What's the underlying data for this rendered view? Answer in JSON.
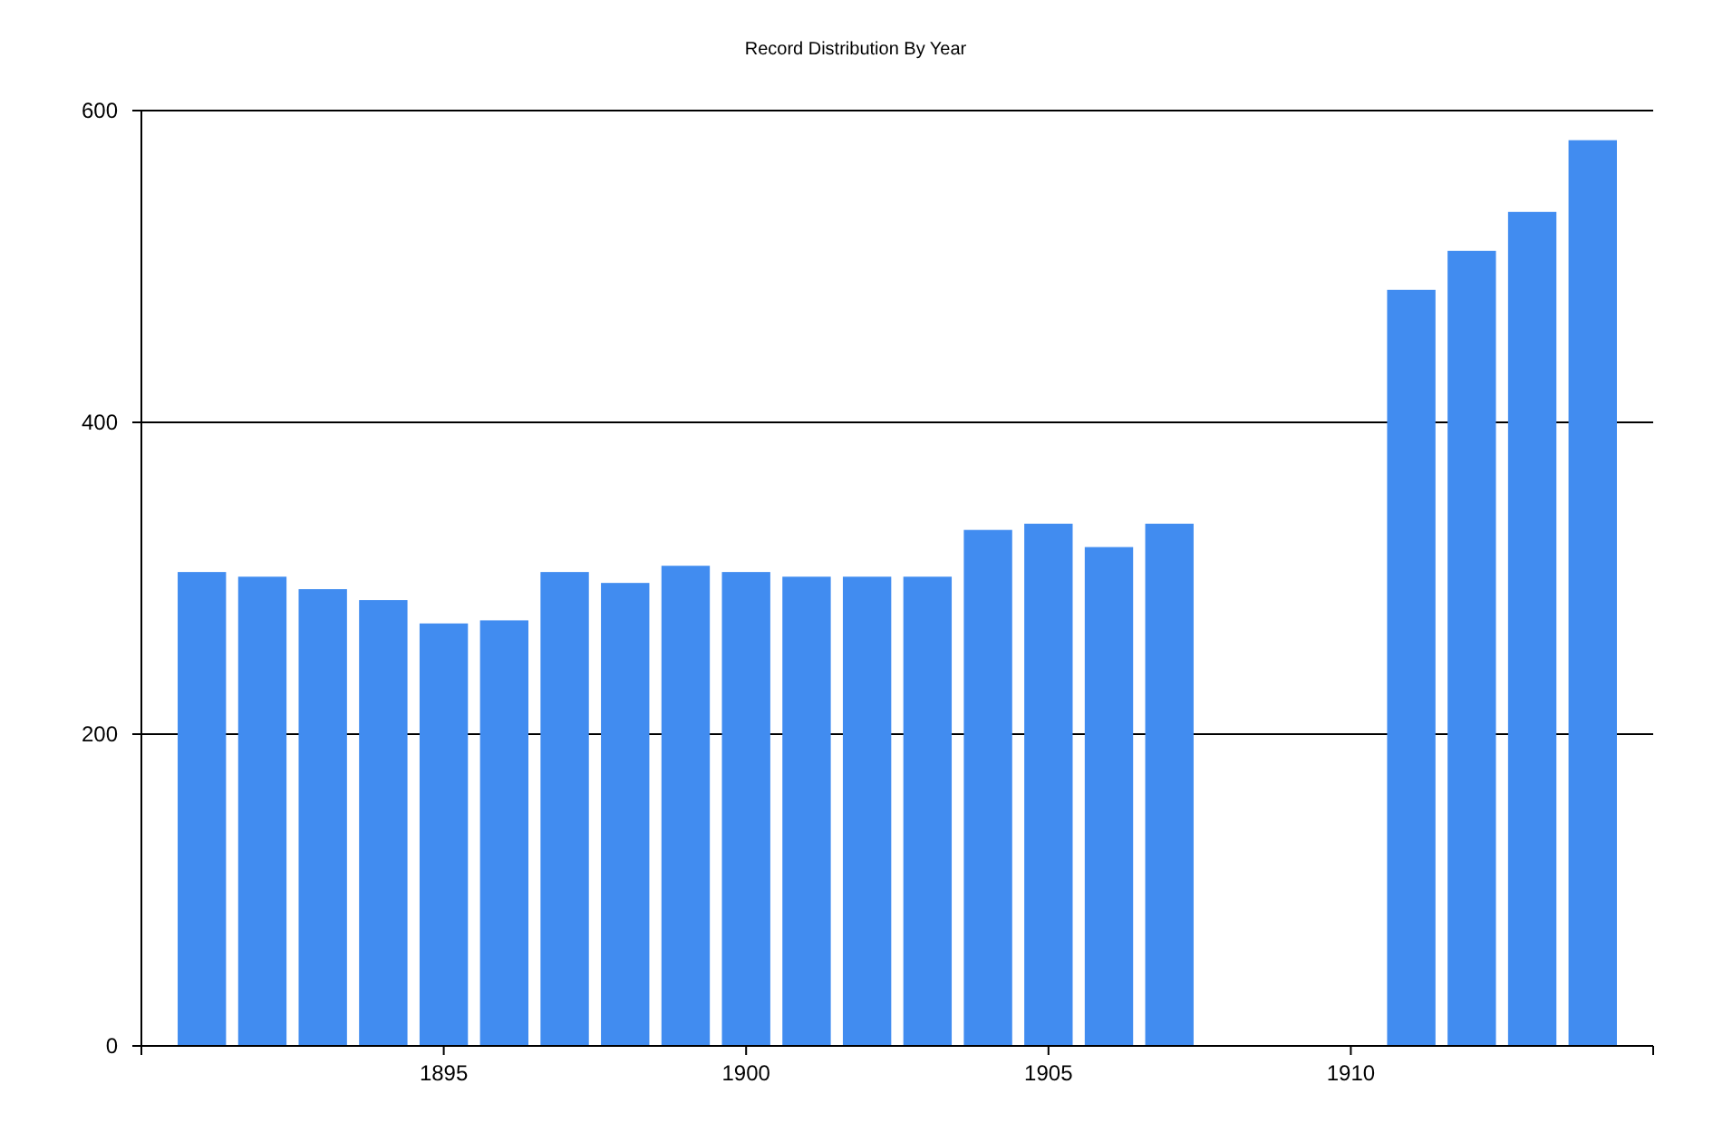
{
  "chart_data": {
    "type": "bar",
    "title": "Record Distribution By Year",
    "x": [
      1891,
      1892,
      1893,
      1894,
      1895,
      1896,
      1897,
      1898,
      1899,
      1900,
      1901,
      1902,
      1903,
      1904,
      1905,
      1906,
      1907,
      1911,
      1912,
      1913,
      1914
    ],
    "series": [
      {
        "color": "#418cf0",
        "values": [
          304,
          301,
          293,
          286,
          271,
          273,
          304,
          297,
          308,
          304,
          301,
          301,
          301,
          331,
          335,
          320,
          335,
          485,
          510,
          535,
          581
        ]
      }
    ],
    "xlim": [
      1890,
      1915
    ],
    "ylim": [
      0,
      600
    ],
    "xticks": [
      1895,
      1900,
      1905,
      1910
    ],
    "yticks": [
      0,
      200,
      400,
      600
    ]
  }
}
